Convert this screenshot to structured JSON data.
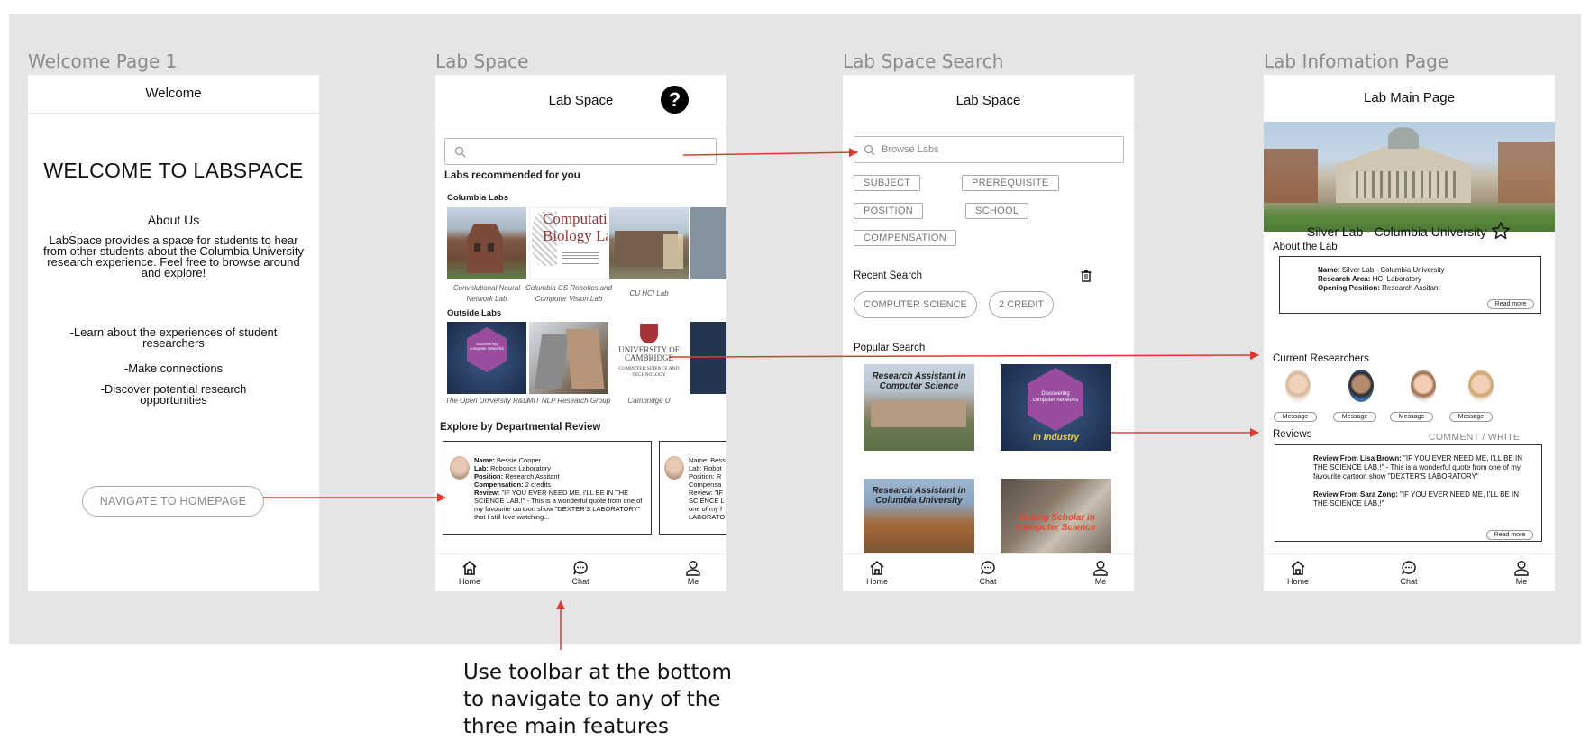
{
  "frames": {
    "f1": "Welcome Page 1",
    "f2": "Lab Space",
    "f3": "Lab Space Search",
    "f4": "Lab Infomation Page"
  },
  "welcome": {
    "header": "Welcome",
    "title": "WELCOME TO LABSPACE",
    "about_heading": "About Us",
    "about_text": "LabSpace provides a space for students to hear from other students about the Columbia University research experience. Feel free to browse around and explore!",
    "bullets": [
      "-Learn about the experiences of student researchers",
      "-Make connections",
      "-Discover potential research opportunities"
    ],
    "nav_button": "NAVIGATE TO HOMEPAGE"
  },
  "labspace": {
    "header": "Lab Space",
    "recommended": "Labs recommended for you",
    "columbia_heading": "Columbia Labs",
    "columbia_items": [
      {
        "caption": "Convolutional Neural Network Lab"
      },
      {
        "caption": "Columbia CS Robotics and Computer Vision Lab",
        "art_text": "Computation Biology La"
      },
      {
        "caption": "CU HCI Lab"
      }
    ],
    "outside_heading": "Outside Labs",
    "outside_items": [
      {
        "caption": "The Open University R&D",
        "art_text": "Discovering computer networks"
      },
      {
        "caption": "MIT NLP Research Group"
      },
      {
        "caption": "Cambridge U",
        "art_text": "UNIVERSITY OF CAMBRIDGE",
        "art_sub": "COMPUTER SCIENCE AND TECHNOLOGY"
      }
    ],
    "explore_heading": "Explore by Departmental Review",
    "review": {
      "name_label": "Name:",
      "name": "Bessie Cooper",
      "lab_label": "Lab:",
      "lab": "Robotics Laboratory",
      "position_label": "Position:",
      "position": "Research Assitant",
      "comp_label": "Compensation:",
      "comp": "2 credits",
      "review_label": "Review:",
      "review": "\"IF YOU EVER NEED ME, I'LL BE IN THE SCIENCE LAB.!\" - This is a wonderful quote from one of my favourite cartoon show \"DEXTER'S LABORATORY\" that I still love watching..."
    },
    "review2": {
      "name": "Name: Bess",
      "lab": "Lab: Robot",
      "position": "Position: R",
      "comp": "Compensa",
      "r1": "Review: \"IF",
      "r2": "SCIENCE L",
      "r3": "one of my f",
      "r4": "LABORATO"
    }
  },
  "search": {
    "header": "Lab Space",
    "placeholder": "Browse Labs",
    "tags": [
      "SUBJECT",
      "PREREQUISITE",
      "POSITION",
      "SCHOOL",
      "COMPENSATION"
    ],
    "recent_heading": "Recent Search",
    "recent": [
      "COMPUTER SCIENCE",
      "2 CREDIT"
    ],
    "popular_heading": "Popular Search",
    "popular": [
      "Research Assistant in Computer Science",
      "In Industry",
      "Research Assistant in Columbia University",
      "Visiting Scholar in Computer Science"
    ],
    "popular_badge": "Discovering computer networks"
  },
  "labinfo": {
    "header": "Lab Main Page",
    "lab_name": "Silver Lab - Columbia University",
    "about_heading": "About the Lab",
    "name_label": "Name:",
    "name": "Silver Lab - Columbia University",
    "area_label": "Research Area:",
    "area": "HCI Laboratory",
    "opening_label": "Opening Position:",
    "opening": "Research Assitant",
    "read_more": "Read more",
    "researchers_heading": "Current Researchers",
    "message": "Message",
    "reviews_heading": "Reviews",
    "comment_write": "COMMENT / WRITE",
    "review1_label": "Review From Lisa Brown:",
    "review1": "\"IF YOU EVER NEED ME, I'LL BE IN THE SCIENCE LAB.!\" - This is a wonderful quote from one of my favourite cartoon show \"DEXTER'S LABORATORY\"",
    "review2_label": "Review From Sara Zong:",
    "review2": "\"IF YOU EVER NEED ME, I'LL BE IN THE SCIENCE LAB.!\""
  },
  "toolbar": {
    "home": "Home",
    "chat": "Chat",
    "me": "Me"
  },
  "annotation": "Use toolbar at the bottom to navigate to any of the three main features",
  "colors": {
    "arrow": "#e0382e",
    "canvas": "#e5e5e5"
  }
}
